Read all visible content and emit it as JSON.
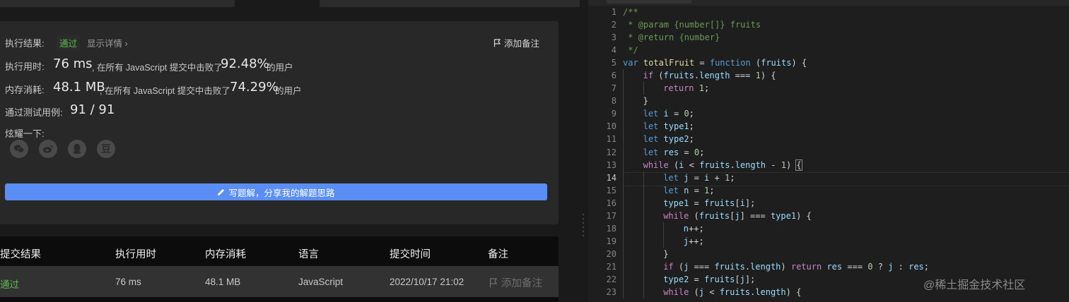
{
  "result": {
    "status_label": "执行结果:",
    "status_value": "通过",
    "detail_link": "显示详情 ›",
    "add_note": "添加备注",
    "time_label": "执行用时:",
    "time_value": "76 ms",
    "time_text": ", 在所有 JavaScript 提交中击败了",
    "time_percent": "92.48%",
    "time_suffix": "的用户",
    "mem_label": "内存消耗:",
    "mem_value": "48.1 MB",
    "mem_text": ", 在所有 JavaScript 提交中击败了",
    "mem_percent": "74.29%",
    "mem_suffix": "的用户",
    "tests_label": "通过测试用例:",
    "tests_value": "91 / 91",
    "share_label": "炫耀一下:",
    "share_icons": [
      "wechat-icon",
      "weibo-icon",
      "qq-icon",
      "douban-icon"
    ],
    "douban_glyph": "豆",
    "write_button": "写题解，分享我的解题思路"
  },
  "submissions": {
    "headers": [
      "提交结果",
      "执行用时",
      "内存消耗",
      "语言",
      "提交时间",
      "备注"
    ],
    "row": {
      "status": "通过",
      "time": "76 ms",
      "memory": "48.1 MB",
      "language": "JavaScript",
      "submitted_at": "2022/10/17 21:02",
      "note": "添加备注"
    }
  },
  "editor": {
    "line_numbers": [
      "1",
      "2",
      "3",
      "4",
      "5",
      "6",
      "7",
      "8",
      "9",
      "10",
      "11",
      "12",
      "13",
      "14",
      "15",
      "16",
      "17",
      "18",
      "19",
      "20",
      "21",
      "22",
      "23"
    ],
    "active_line": "14"
  },
  "watermark": "@稀土掘金技术社区",
  "colors": {
    "accent_blue": "#5b8ef5",
    "pass_green": "#5fb852",
    "editor_bg": "#1e1e1e"
  }
}
